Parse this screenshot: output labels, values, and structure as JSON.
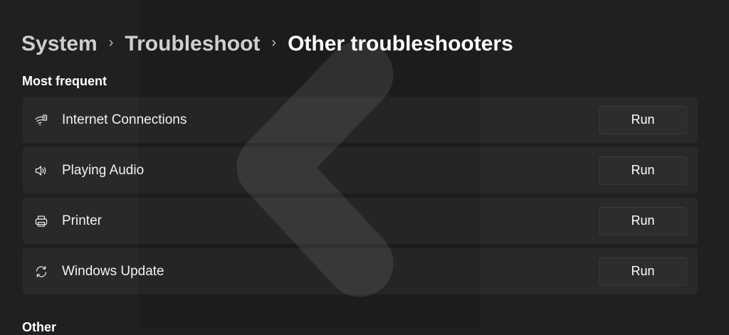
{
  "breadcrumb": {
    "items": [
      "System",
      "Troubleshoot",
      "Other troubleshooters"
    ],
    "separator": "›"
  },
  "sections": {
    "most_frequent": {
      "title": "Most frequent",
      "items": [
        {
          "label": "Internet Connections",
          "icon": "wifi-signal-icon",
          "button": "Run"
        },
        {
          "label": "Playing Audio",
          "icon": "speaker-icon",
          "button": "Run"
        },
        {
          "label": "Printer",
          "icon": "printer-icon",
          "button": "Run"
        },
        {
          "label": "Windows Update",
          "icon": "sync-icon",
          "button": "Run"
        }
      ]
    },
    "other": {
      "title": "Other"
    }
  },
  "colors": {
    "background": "#202020",
    "card": "#272727",
    "button": "#2d2d2d",
    "text": "#ffffff"
  }
}
